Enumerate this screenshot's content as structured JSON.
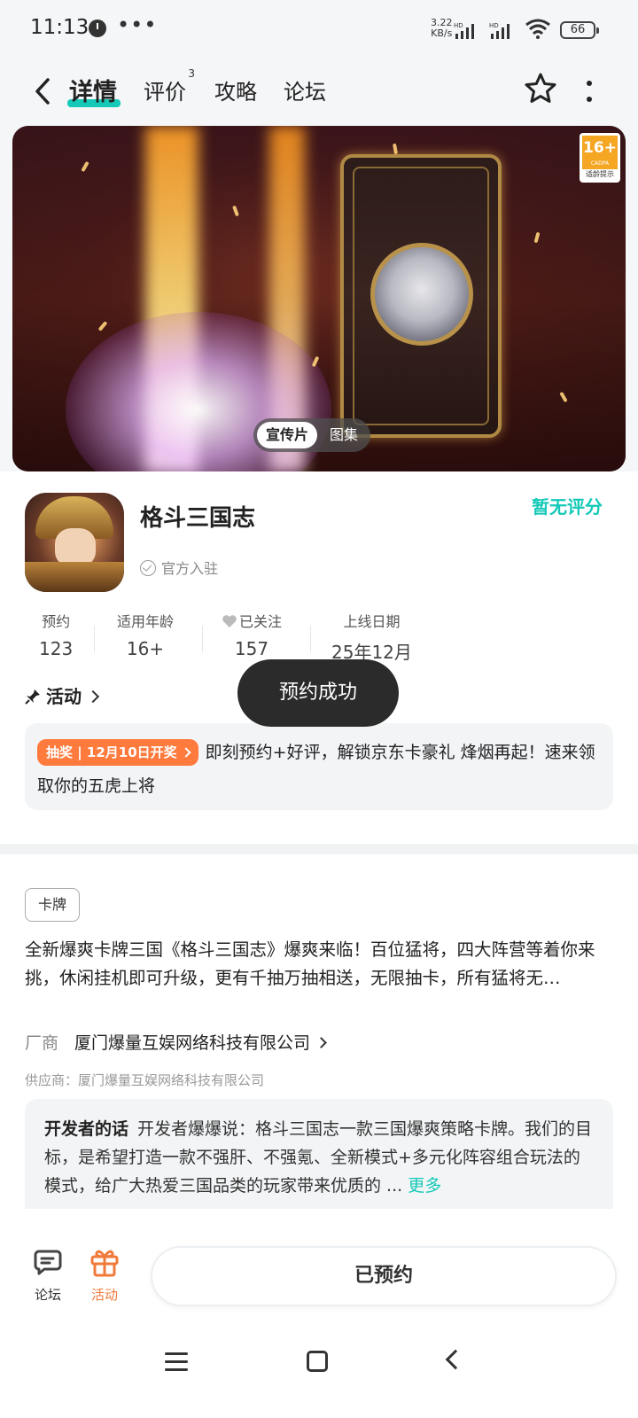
{
  "status_bar": {
    "time": "11:13",
    "dots": "•••",
    "speed_value": "3.22",
    "speed_unit": "KB/s",
    "battery": "66"
  },
  "header": {
    "tabs": [
      {
        "label": "详情",
        "active": true
      },
      {
        "label": "评价",
        "badge": "3"
      },
      {
        "label": "攻略"
      },
      {
        "label": "论坛"
      }
    ]
  },
  "banner": {
    "age_rating": "16+",
    "age_org": "CADPA",
    "age_tip": "适龄提示",
    "media_options": [
      "宣传片",
      "图集"
    ]
  },
  "app": {
    "name": "格斗三国志",
    "rating_text": "暂无评分",
    "official_label": "官方入驻"
  },
  "stats": [
    {
      "label": "预约",
      "value": "123"
    },
    {
      "label": "适用年龄",
      "value": "16+"
    },
    {
      "label": "已关注",
      "value": "157"
    },
    {
      "label": "上线日期",
      "value": "25年12月"
    }
  ],
  "toast": "预约成功",
  "activity": {
    "title": "活动",
    "tag": "抽奖 | 12月10日开奖",
    "text": "即刻预约+好评，解锁京东卡豪礼 烽烟再起！速来领取你的五虎上将"
  },
  "description": {
    "genre_tag": "卡牌",
    "text": "全新爆爽卡牌三国《格斗三国志》爆爽来临！百位猛将，四大阵营等着你来挑，休闲挂机即可升级，更有千抽万抽相送，无限抽卡，所有猛将无…",
    "vendor_label": "厂商",
    "vendor_name": "厦门爆量互娱网络科技有限公司",
    "supplier": "供应商：厦门爆量互娱网络科技有限公司",
    "dev_label": "开发者的话",
    "dev_text": "开发者爆爆说：格斗三国志一款三国爆爽策略卡牌。我们的目标，是希望打造一款不强肝、不强氪、全新模式+多元化阵容组合玩法的模式，给广大热爱三国品类的玩家带来优质的 ...",
    "more": "更多"
  },
  "bottom_bar": {
    "forum_label": "论坛",
    "activity_label": "活动",
    "reserve_button": "已预约"
  },
  "colors": {
    "accent": "#15c9b8",
    "orange": "#ff7a3d",
    "activity_icon": "#f07a3a"
  }
}
